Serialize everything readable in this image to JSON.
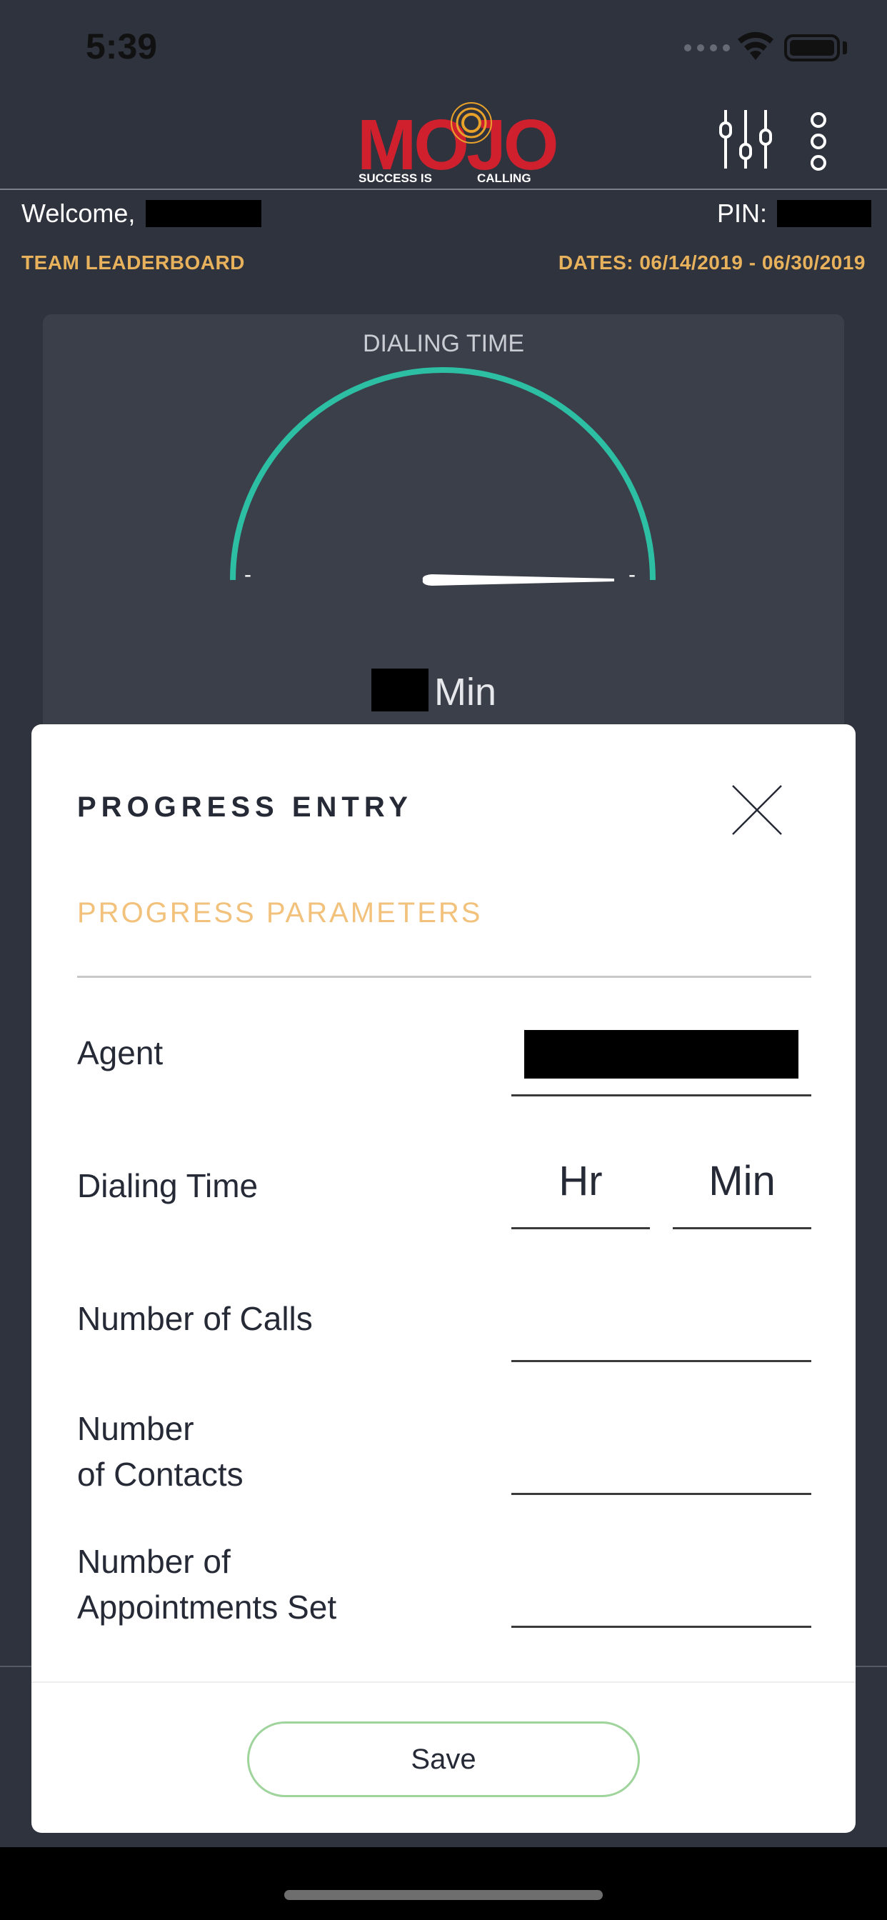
{
  "status_bar": {
    "time": "5:39"
  },
  "header": {
    "logo_text": "MOJO",
    "logo_tagline_left": "SUCCESS IS",
    "logo_tagline_right": "CALLING",
    "icons": [
      "sliders-icon",
      "more-vertical-icon"
    ]
  },
  "info": {
    "welcome_label": "Welcome,",
    "pin_label": "PIN:",
    "leaderboard_label": "TEAM LEADERBOARD",
    "dates_label": "DATES: 06/14/2019 - 06/30/2019"
  },
  "gauge": {
    "title": "DIALING TIME",
    "unit": "Min",
    "min_tick": "-",
    "max_tick": "-",
    "arc_color": "#2dbfa3"
  },
  "modal": {
    "title": "PROGRESS ENTRY",
    "section": "PROGRESS PARAMETERS",
    "fields": [
      {
        "label": "Agent",
        "value": ""
      },
      {
        "label": "Dialing Time",
        "hr_placeholder": "Hr",
        "min_placeholder": "Min"
      },
      {
        "label": "Number of Calls",
        "value": ""
      },
      {
        "label_line1": "Number",
        "label_line2": "of Contacts",
        "value": ""
      },
      {
        "label_line1": "Number of",
        "label_line2": "Appointments Set",
        "value": ""
      }
    ],
    "save_label": "Save",
    "accent_color": "#f2c27c",
    "save_border_color": "#9fd49c"
  }
}
